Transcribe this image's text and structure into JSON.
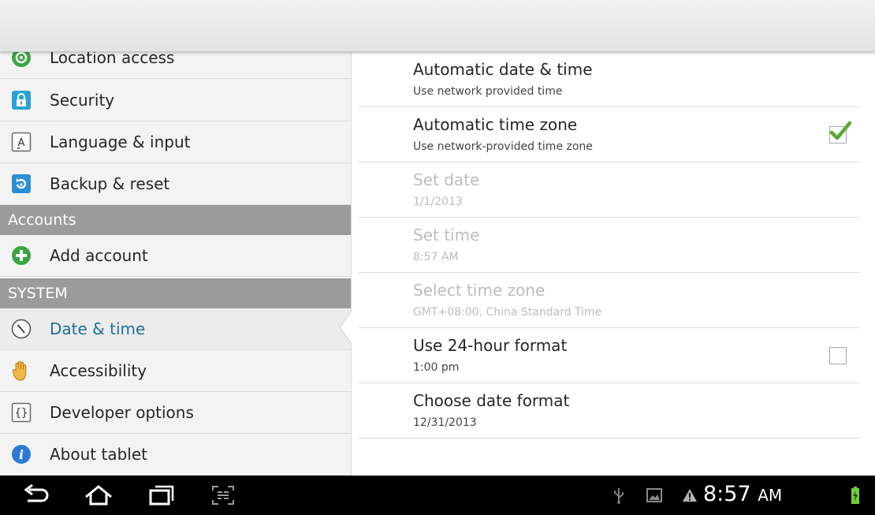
{
  "sidebar": {
    "items": [
      {
        "label": "Location access",
        "icon": "location-icon",
        "color": "#3aa640"
      },
      {
        "label": "Security",
        "icon": "lock-icon",
        "color": "#29a3d6"
      },
      {
        "label": "Language & input",
        "icon": "keyboard-icon",
        "color": "#5a5a5a"
      },
      {
        "label": "Backup & reset",
        "icon": "backup-icon",
        "color": "#2c8fd6"
      }
    ],
    "accounts_header": "Accounts",
    "add_account": {
      "label": "Add account",
      "icon": "plus-circle-icon",
      "color": "#3aa640"
    },
    "system_header": "SYSTEM",
    "system_items": [
      {
        "label": "Date & time",
        "icon": "clock-icon",
        "active": true
      },
      {
        "label": "Accessibility",
        "icon": "hand-icon"
      },
      {
        "label": "Developer options",
        "icon": "braces-icon"
      },
      {
        "label": "About tablet",
        "icon": "info-icon",
        "color": "#2c7ad6"
      }
    ]
  },
  "settings": [
    {
      "title": "Automatic date & time",
      "summary": "Use network provided time",
      "enabled": true,
      "checkbox": "none"
    },
    {
      "title": "Automatic time zone",
      "summary": "Use network-provided time zone",
      "enabled": true,
      "checkbox": "checked"
    },
    {
      "title": "Set date",
      "summary": "1/1/2013",
      "enabled": false,
      "checkbox": "none"
    },
    {
      "title": "Set time",
      "summary": "8:57 AM",
      "enabled": false,
      "checkbox": "none"
    },
    {
      "title": "Select time zone",
      "summary": "GMT+08:00, China Standard Time",
      "enabled": false,
      "checkbox": "none"
    },
    {
      "title": "Use 24-hour format",
      "summary": "1:00 pm",
      "enabled": true,
      "checkbox": "unchecked"
    },
    {
      "title": "Choose date format",
      "summary": "12/31/2013",
      "enabled": true,
      "checkbox": "none"
    }
  ],
  "navbar": {
    "buttons": [
      "back-icon",
      "home-icon",
      "recent-apps-icon",
      "screenshot-icon"
    ],
    "status_icons": [
      "usb-icon",
      "gallery-icon",
      "warning-icon",
      "battery-icon"
    ],
    "time": "8:57",
    "ampm": "AM"
  },
  "colors": {
    "accent": "#1f6f9a",
    "check": "#5aa82f",
    "section_header": "#9b9b9b"
  }
}
